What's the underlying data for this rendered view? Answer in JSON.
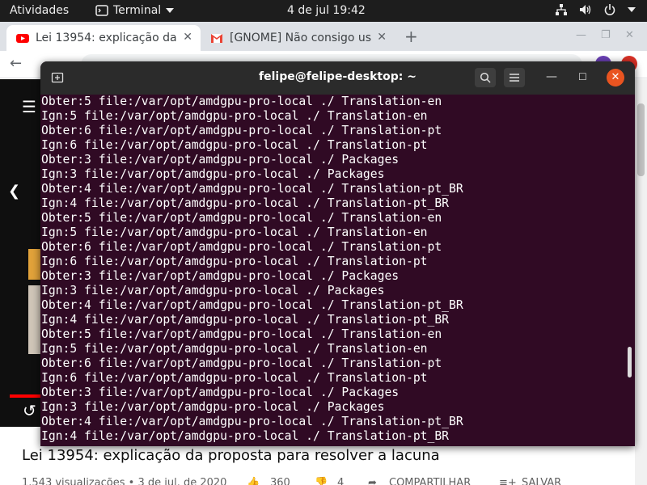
{
  "topbar": {
    "activities": "Atividades",
    "app_name": "Terminal",
    "clock": "4 de jul  19:42"
  },
  "browser": {
    "tabs": [
      {
        "title": "Lei 13954: explicação da p",
        "icon": "youtube-icon",
        "active": true
      },
      {
        "title": "[GNOME] Não consigo us",
        "icon": "gmail-icon",
        "active": false
      }
    ],
    "new_tab": "+"
  },
  "video": {
    "title": "Lei 13954: explicação da proposta para resolver a lacuna",
    "views_date": "1.543 visualizações • 3 de jul. de 2020",
    "likes": "360",
    "dislikes": "4",
    "share": "COMPARTILHAR",
    "save": "SALVAR"
  },
  "terminal": {
    "title": "felipe@felipe-desktop: ~",
    "lines": [
      "Obter:5 file:/var/opt/amdgpu-pro-local ./ Translation-en",
      "Ign:5 file:/var/opt/amdgpu-pro-local ./ Translation-en",
      "Obter:6 file:/var/opt/amdgpu-pro-local ./ Translation-pt",
      "Ign:6 file:/var/opt/amdgpu-pro-local ./ Translation-pt",
      "Obter:3 file:/var/opt/amdgpu-pro-local ./ Packages",
      "Ign:3 file:/var/opt/amdgpu-pro-local ./ Packages",
      "Obter:4 file:/var/opt/amdgpu-pro-local ./ Translation-pt_BR",
      "Ign:4 file:/var/opt/amdgpu-pro-local ./ Translation-pt_BR",
      "Obter:5 file:/var/opt/amdgpu-pro-local ./ Translation-en",
      "Ign:5 file:/var/opt/amdgpu-pro-local ./ Translation-en",
      "Obter:6 file:/var/opt/amdgpu-pro-local ./ Translation-pt",
      "Ign:6 file:/var/opt/amdgpu-pro-local ./ Translation-pt",
      "Obter:3 file:/var/opt/amdgpu-pro-local ./ Packages",
      "Ign:3 file:/var/opt/amdgpu-pro-local ./ Packages",
      "Obter:4 file:/var/opt/amdgpu-pro-local ./ Translation-pt_BR",
      "Ign:4 file:/var/opt/amdgpu-pro-local ./ Translation-pt_BR",
      "Obter:5 file:/var/opt/amdgpu-pro-local ./ Translation-en",
      "Ign:5 file:/var/opt/amdgpu-pro-local ./ Translation-en",
      "Obter:6 file:/var/opt/amdgpu-pro-local ./ Translation-pt",
      "Ign:6 file:/var/opt/amdgpu-pro-local ./ Translation-pt",
      "Obter:3 file:/var/opt/amdgpu-pro-local ./ Packages",
      "Ign:3 file:/var/opt/amdgpu-pro-local ./ Packages",
      "Obter:4 file:/var/opt/amdgpu-pro-local ./ Translation-pt_BR",
      "Ign:4 file:/var/opt/amdgpu-pro-local ./ Translation-pt_BR"
    ]
  },
  "colors": {
    "terminal_bg": "#300a24",
    "header_bg": "#2b2b2b",
    "close_button": "#e95420",
    "youtube_red": "#ff0000"
  }
}
